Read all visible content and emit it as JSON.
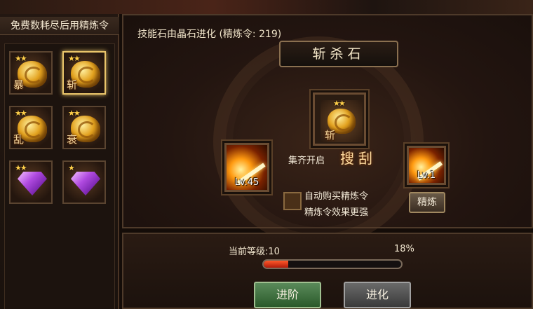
{
  "left_panel": {
    "title": "免费数耗尽后用精炼令",
    "items": [
      {
        "type": "stone",
        "stars": "★★",
        "glyph": "暴",
        "selected": false,
        "icon": "gold-skill-stone-icon"
      },
      {
        "type": "stone",
        "stars": "★★",
        "glyph": "斩",
        "selected": true,
        "icon": "gold-skill-stone-icon"
      },
      {
        "type": "stone",
        "stars": "★★",
        "glyph": "乱",
        "selected": false,
        "icon": "gold-skill-stone-icon"
      },
      {
        "type": "stone",
        "stars": "★★",
        "glyph": "衰",
        "selected": false,
        "icon": "gold-skill-stone-icon"
      },
      {
        "type": "gem",
        "stars": "★★",
        "glyph": "",
        "selected": false,
        "icon": "purple-crystal-icon"
      },
      {
        "type": "gem",
        "stars": "★",
        "glyph": "",
        "selected": false,
        "icon": "purple-crystal-icon"
      }
    ]
  },
  "main": {
    "title": "技能石由晶石进化 (精炼令: 219)",
    "stone_name": "斩杀石",
    "center_stone": {
      "stars": "★★",
      "glyph": "斩",
      "icon": "gold-skill-stone-icon"
    },
    "left_skill": {
      "level": "Lv.45",
      "icon": "sword-slash-skill-icon"
    },
    "right_skill": {
      "level": "Lv.1",
      "icon": "sword-slash-skill-icon"
    },
    "collect_text": "集齐开启",
    "collect_skill": "搜刮",
    "auto_buy_label": "自动购买精炼令",
    "auto_buy_checked": false,
    "hint_text": "精炼令效果更强",
    "refine_button": "精炼"
  },
  "bottom": {
    "level_text": "当前等级:10",
    "percent_text": "18%",
    "progress": 0.18,
    "advance_button": "进阶",
    "evolve_button": "进化"
  },
  "colors": {
    "accent_gold": "#e9c56a",
    "progress_fill": "#ff5a2a",
    "advance_green": "#2a5a2a"
  }
}
